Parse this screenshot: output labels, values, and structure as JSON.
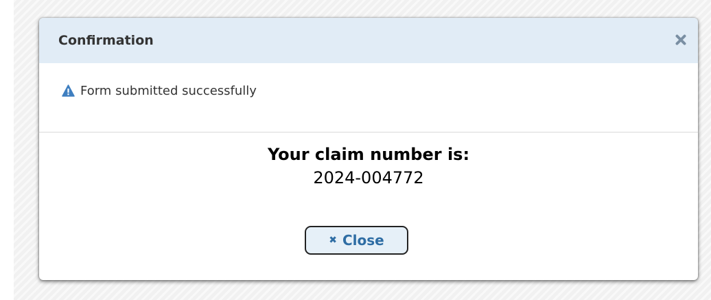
{
  "dialog": {
    "title": "Confirmation",
    "message": "Form submitted successfully",
    "claim_label": "Your claim number is:",
    "claim_number": "2024-004772",
    "close_button": {
      "label": "Close",
      "icon": "close-icon"
    },
    "header_close_icon": "close-icon",
    "message_icon": "warning-icon"
  },
  "colors": {
    "titlebar_bg": "#e1ecf6",
    "accent": "#2e6da4",
    "icon_gray": "#7a8fa3",
    "button_bg": "#e6f0f8"
  }
}
